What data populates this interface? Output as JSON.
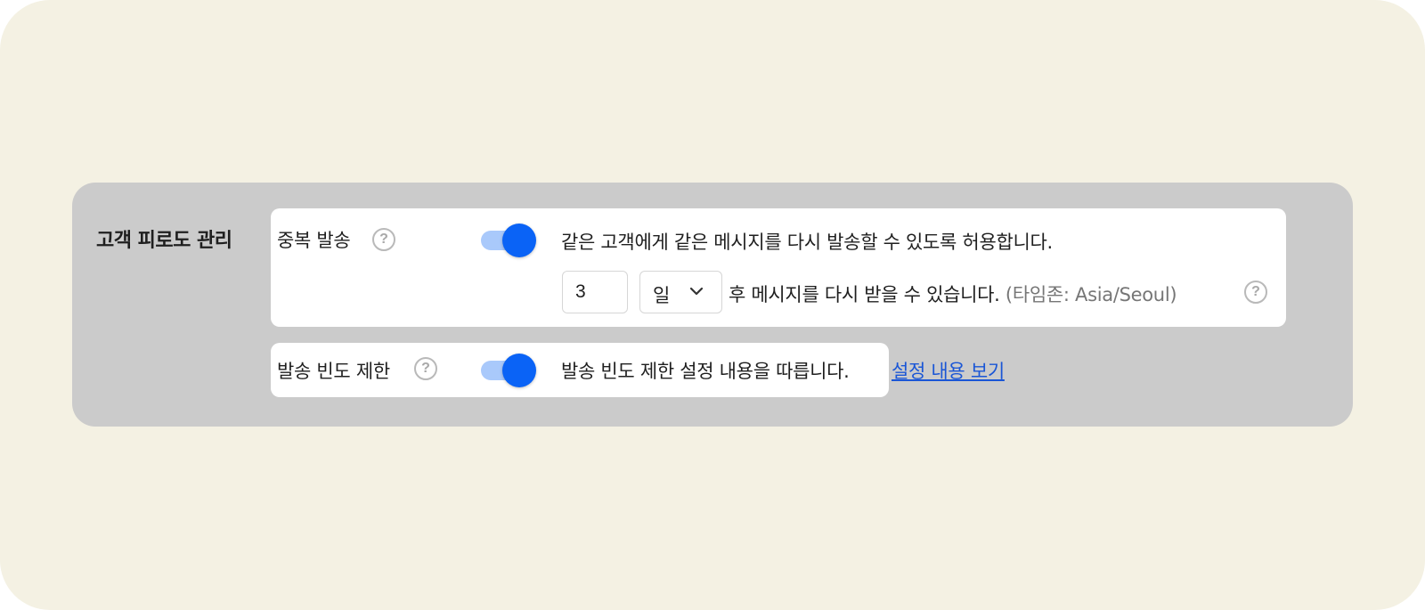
{
  "section": {
    "title": "고객 피로도 관리"
  },
  "duplicate_send": {
    "label": "중복 발송",
    "help_glyph": "?",
    "toggle_on": true,
    "description": "같은 고객에게 같은 메시지를 다시 발송할 수 있도록 허용합니다.",
    "interval_value": "3",
    "interval_unit": "일",
    "interval_suffix": "후 메시지를 다시 받을 수 있습니다.",
    "timezone_text": "(타임존: Asia/Seoul)",
    "timezone_help_glyph": "?"
  },
  "frequency_limit": {
    "label": "발송 빈도 제한",
    "help_glyph": "?",
    "toggle_on": true,
    "description": "발송 빈도 제한 설정 내용을 따릅니다.",
    "link_label": "설정 내용 보기"
  },
  "colors": {
    "background": "#f4f1e3",
    "panel": "#cbcbcb",
    "card": "#ffffff",
    "toggle_knob": "#0a63f6",
    "toggle_track": "#a9c9fb",
    "link": "#1a56d6"
  },
  "icons": {
    "help": "question-circle-icon",
    "select_arrow": "chevron-down-icon"
  }
}
